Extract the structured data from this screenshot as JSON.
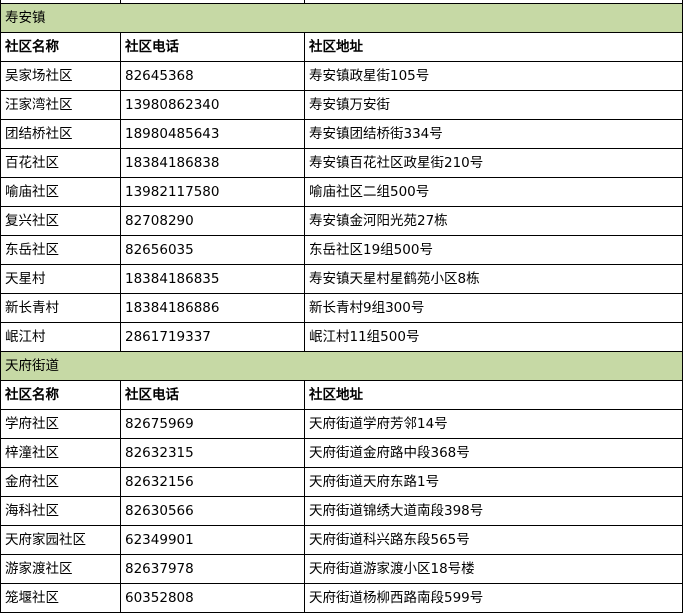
{
  "colors": {
    "section_bg": "#c6d9a5",
    "grid_line": "#000000"
  },
  "headers": {
    "name": "社区名称",
    "phone": "社区电话",
    "address": "社区地址"
  },
  "sections": [
    {
      "title": "寿安镇",
      "rows": [
        {
          "name": "吴家场社区",
          "phone": "82645368",
          "address": "寿安镇政星街105号"
        },
        {
          "name": "汪家湾社区",
          "phone": "13980862340",
          "address": "寿安镇万安街"
        },
        {
          "name": "团结桥社区",
          "phone": "18980485643",
          "address": "寿安镇团结桥街334号"
        },
        {
          "name": "百花社区",
          "phone": "18384186838",
          "address": "寿安镇百花社区政星街210号"
        },
        {
          "name": "喻庙社区",
          "phone": "13982117580",
          "address": "喻庙社区二组500号"
        },
        {
          "name": "复兴社区",
          "phone": "82708290",
          "address": "寿安镇金河阳光苑27栋"
        },
        {
          "name": "东岳社区",
          "phone": "82656035",
          "address": "东岳社区19组500号"
        },
        {
          "name": "天星村",
          "phone": "18384186835",
          "address": "寿安镇天星村星鹤苑小区8栋"
        },
        {
          "name": "新长青村",
          "phone": "18384186886",
          "address": "新长青村9组300号"
        },
        {
          "name": "岷江村",
          "phone": "2861719337",
          "address": "岷江村11组500号"
        }
      ]
    },
    {
      "title": "天府街道",
      "rows": [
        {
          "name": "学府社区",
          "phone": "82675969",
          "address": "天府街道学府芳邻14号"
        },
        {
          "name": "梓潼社区",
          "phone": "82632315",
          "address": "天府街道金府路中段368号"
        },
        {
          "name": "金府社区",
          "phone": "82632156",
          "address": "天府街道天府东路1号"
        },
        {
          "name": "海科社区",
          "phone": "82630566",
          "address": "天府街道锦绣大道南段398号"
        },
        {
          "name": "天府家园社区",
          "phone": "62349901",
          "address": "天府街道科兴路东段565号"
        },
        {
          "name": "游家渡社区",
          "phone": "82637978",
          "address": "天府街道游家渡小区18号楼"
        },
        {
          "name": "笼堰社区",
          "phone": "60352808",
          "address": "天府街道杨柳西路南段599号"
        }
      ]
    }
  ]
}
